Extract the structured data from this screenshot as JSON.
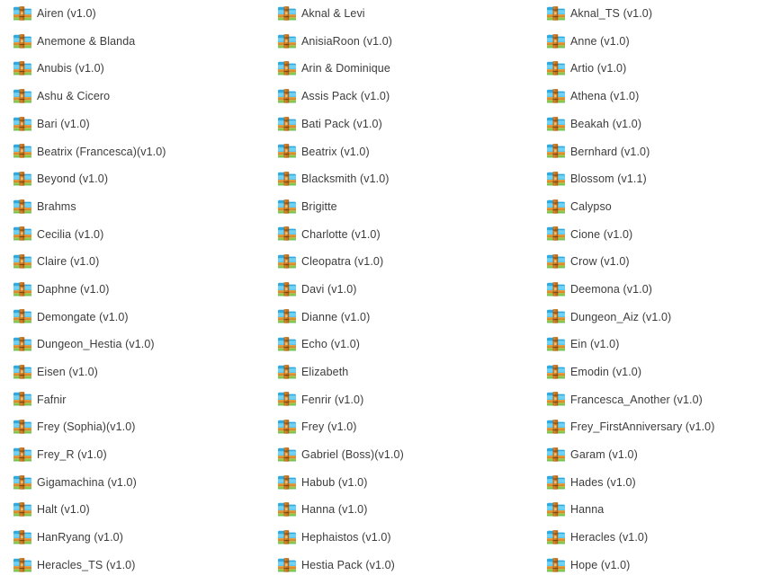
{
  "window": {
    "view_mode": "medium-icons-list",
    "background_color": "#ffffff",
    "text_color": "#3c3c3c",
    "icon": {
      "name": "folder-with-book-icon",
      "folder_color": "#3db7e4",
      "folder_color_light": "#8fd9f4",
      "book_color": "#c8761e",
      "book_color_dark": "#8a4a12",
      "base_color": "#7cc143"
    }
  },
  "columns": [
    {
      "index": 0,
      "items": [
        {
          "label": "Airen (v1.0)"
        },
        {
          "label": "Anemone & Blanda"
        },
        {
          "label": "Anubis (v1.0)"
        },
        {
          "label": "Ashu & Cicero"
        },
        {
          "label": "Bari (v1.0)"
        },
        {
          "label": "Beatrix (Francesca)(v1.0)"
        },
        {
          "label": "Beyond (v1.0)"
        },
        {
          "label": "Brahms"
        },
        {
          "label": "Cecilia (v1.0)"
        },
        {
          "label": "Claire (v1.0)"
        },
        {
          "label": "Daphne (v1.0)"
        },
        {
          "label": "Demongate (v1.0)"
        },
        {
          "label": "Dungeon_Hestia (v1.0)"
        },
        {
          "label": "Eisen (v1.0)"
        },
        {
          "label": "Fafnir"
        },
        {
          "label": "Frey (Sophia)(v1.0)"
        },
        {
          "label": "Frey_R (v1.0)"
        },
        {
          "label": "Gigamachina (v1.0)"
        },
        {
          "label": "Halt (v1.0)"
        },
        {
          "label": "HanRyang (v1.0)"
        },
        {
          "label": "Heracles_TS (v1.0)"
        }
      ]
    },
    {
      "index": 1,
      "items": [
        {
          "label": "Aknal & Levi"
        },
        {
          "label": "AnisiaRoon (v1.0)"
        },
        {
          "label": "Arin & Dominique"
        },
        {
          "label": "Assis Pack (v1.0)"
        },
        {
          "label": "Bati Pack (v1.0)"
        },
        {
          "label": "Beatrix (v1.0)"
        },
        {
          "label": "Blacksmith (v1.0)"
        },
        {
          "label": "Brigitte"
        },
        {
          "label": "Charlotte (v1.0)"
        },
        {
          "label": "Cleopatra (v1.0)"
        },
        {
          "label": "Davi (v1.0)"
        },
        {
          "label": "Dianne (v1.0)"
        },
        {
          "label": "Echo (v1.0)"
        },
        {
          "label": "Elizabeth"
        },
        {
          "label": "Fenrir (v1.0)"
        },
        {
          "label": "Frey (v1.0)"
        },
        {
          "label": "Gabriel (Boss)(v1.0)"
        },
        {
          "label": "Habub (v1.0)"
        },
        {
          "label": "Hanna (v1.0)"
        },
        {
          "label": "Hephaistos (v1.0)"
        },
        {
          "label": "Hestia Pack (v1.0)"
        }
      ]
    },
    {
      "index": 2,
      "items": [
        {
          "label": "Aknal_TS (v1.0)"
        },
        {
          "label": "Anne (v1.0)"
        },
        {
          "label": "Artio (v1.0)"
        },
        {
          "label": "Athena (v1.0)"
        },
        {
          "label": "Beakah (v1.0)"
        },
        {
          "label": "Bernhard (v1.0)"
        },
        {
          "label": "Blossom (v1.1)"
        },
        {
          "label": "Calypso"
        },
        {
          "label": "Cione (v1.0)"
        },
        {
          "label": "Crow (v1.0)"
        },
        {
          "label": "Deemona (v1.0)"
        },
        {
          "label": "Dungeon_Aiz (v1.0)"
        },
        {
          "label": "Ein (v1.0)"
        },
        {
          "label": "Emodin (v1.0)"
        },
        {
          "label": "Francesca_Another (v1.0)"
        },
        {
          "label": "Frey_FirstAnniversary (v1.0)"
        },
        {
          "label": "Garam (v1.0)"
        },
        {
          "label": "Hades (v1.0)"
        },
        {
          "label": "Hanna"
        },
        {
          "label": "Heracles (v1.0)"
        },
        {
          "label": "Hope (v1.0)"
        }
      ]
    }
  ]
}
